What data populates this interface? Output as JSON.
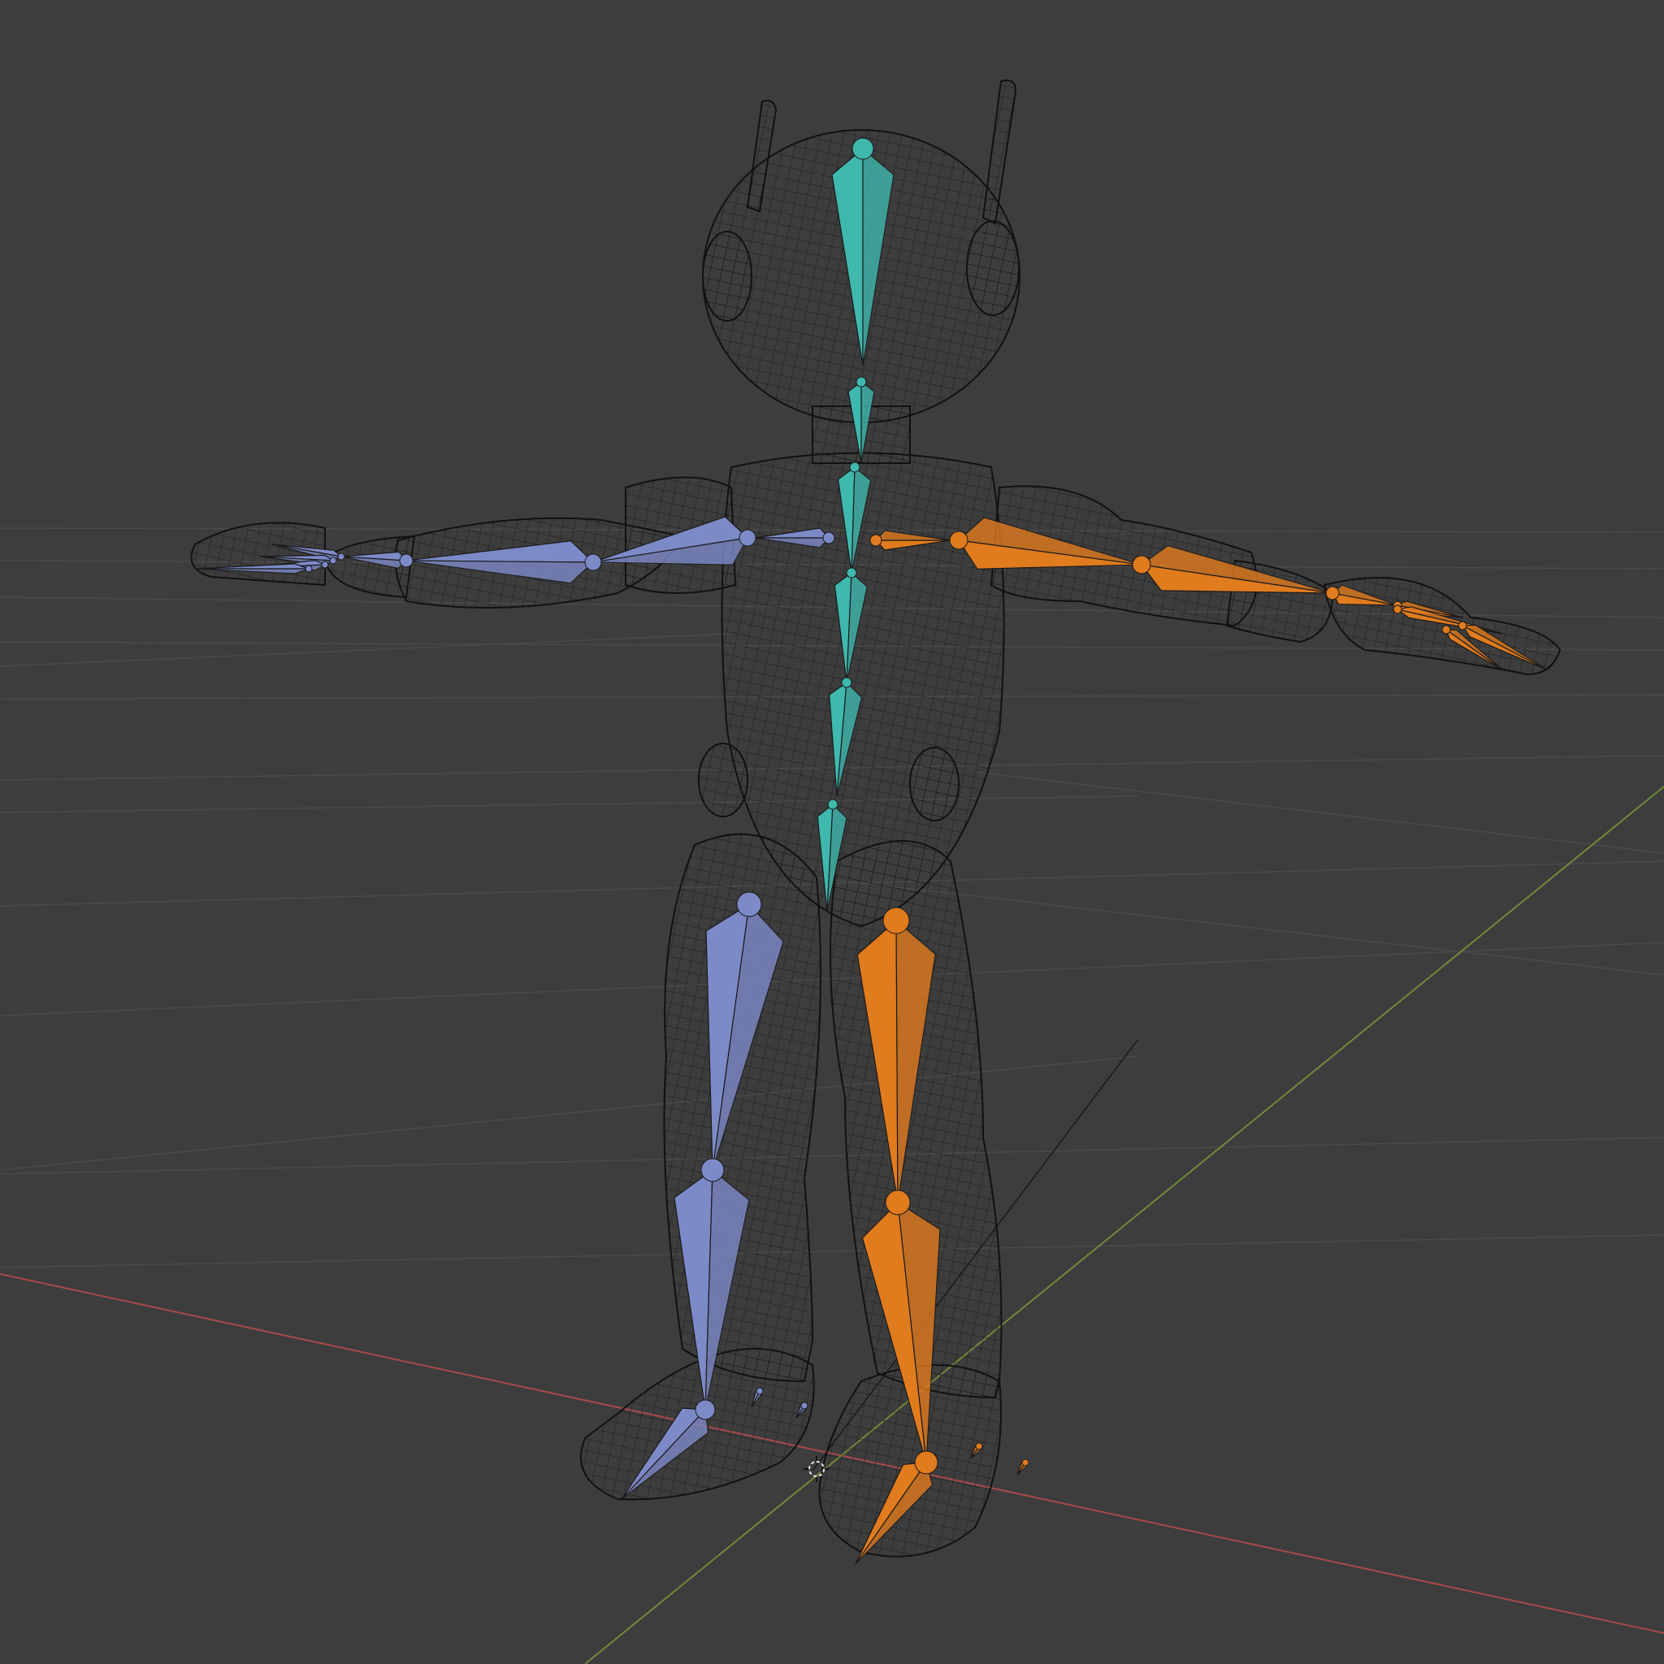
{
  "viewport": {
    "background_color": "#3d3d3d",
    "grid_color": "#4a4a4a",
    "axis_x_color": "#a84a4a",
    "axis_y_color": "#6f8a3a",
    "wireframe_color": "#111111",
    "cursor_icon": "3d-cursor-icon"
  },
  "armature": {
    "colors": {
      "center": "#3fb8ae",
      "left": "#7d8ac8",
      "right": "#e07b1e"
    },
    "bone_groups": [
      {
        "name": "spine",
        "color_key": "center"
      },
      {
        "name": "left-arm",
        "color_key": "left"
      },
      {
        "name": "right-arm",
        "color_key": "right"
      },
      {
        "name": "left-leg",
        "color_key": "left"
      },
      {
        "name": "right-leg",
        "color_key": "right"
      }
    ]
  }
}
